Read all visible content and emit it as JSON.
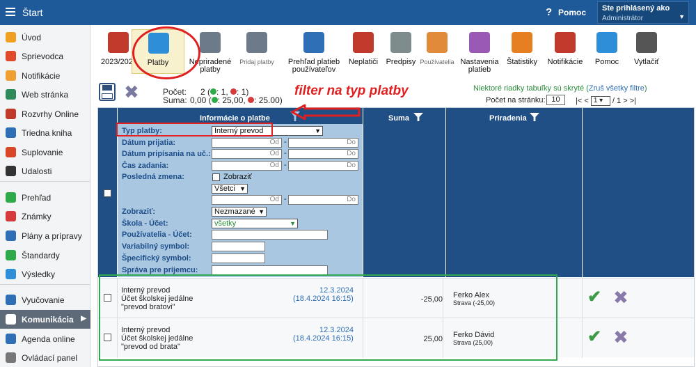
{
  "topbar": {
    "title": "Štart",
    "help_label": "Pomoc",
    "user_label": "Ste prihlásený ako",
    "user_role": "Administrátor"
  },
  "sidebar": {
    "items": [
      {
        "label": "Úvod",
        "icon": "star-icon",
        "color": "#f0a020"
      },
      {
        "label": "Sprievodca",
        "icon": "wand-icon",
        "color": "#e04a2a"
      },
      {
        "label": "Notifikácie",
        "icon": "envelope-icon",
        "color": "#f0a030"
      },
      {
        "label": "Web stránka",
        "icon": "home-icon",
        "color": "#2e8a5a"
      },
      {
        "label": "Rozvrhy Online",
        "icon": "calendar-icon",
        "color": "#c0392b"
      },
      {
        "label": "Triedna kniha",
        "icon": "book-icon",
        "color": "#2e6fb5"
      },
      {
        "label": "Suplovanie",
        "icon": "person-icon",
        "color": "#d9472b"
      },
      {
        "label": "Udalosti",
        "icon": "briefcase-icon",
        "color": "#333333"
      },
      {
        "label": "Prehľad",
        "icon": "check-circle-icon",
        "color": "#2eaa4a"
      },
      {
        "label": "Známky",
        "icon": "ribbon-icon",
        "color": "#d63a3a"
      },
      {
        "label": "Plány a prípravy",
        "icon": "suitcase-icon",
        "color": "#2e6fb5"
      },
      {
        "label": "Štandardy",
        "icon": "shield-icon",
        "color": "#2eaa4a"
      },
      {
        "label": "Výsledky",
        "icon": "bar-chart-icon",
        "color": "#2e8fd8"
      },
      {
        "label": "Vyučovanie",
        "icon": "laptop-icon",
        "color": "#2e6fb5"
      },
      {
        "label": "Komunikácia",
        "icon": "chat-icon",
        "color": "#ffffff"
      },
      {
        "label": "Agenda online",
        "icon": "pen-icon",
        "color": "#2e6fb5"
      },
      {
        "label": "Ovládací panel",
        "icon": "gear-icon",
        "color": "#777777"
      }
    ]
  },
  "toolbar": {
    "items": [
      {
        "label": "2023/2024",
        "icon": "calendar-icon",
        "color": "#c0392b"
      },
      {
        "label": "Platby",
        "icon": "money-bag-icon",
        "color": "#2e8fd8"
      },
      {
        "label": "Nepriradené platby",
        "icon": "money-bag-question-icon",
        "color": "#6c7a89"
      },
      {
        "label": "Pridaj platby",
        "icon": "money-bag-plus-icon",
        "color": "#6c7a89"
      },
      {
        "label": "Prehľad platieb používateľov",
        "icon": "ledger-icon",
        "color": "#2e6fb5"
      },
      {
        "label": "Neplatiči",
        "icon": "money-bag-clock-icon",
        "color": "#c0392b"
      },
      {
        "label": "Predpisy",
        "icon": "document-icon",
        "color": "#7f8c8d"
      },
      {
        "label": "Používatelia",
        "icon": "user-icon",
        "color": "#e08a3a"
      },
      {
        "label": "Nastavenia platieb",
        "icon": "cog-icon",
        "color": "#9b59b6"
      },
      {
        "label": "Štatistiky",
        "icon": "pie-chart-icon",
        "color": "#e67e22"
      },
      {
        "label": "Notifikácie",
        "icon": "phone-icon",
        "color": "#c0392b"
      },
      {
        "label": "Pomoc",
        "icon": "question-icon",
        "color": "#2e8fd8"
      },
      {
        "label": "Vytlačiť",
        "icon": "printer-icon",
        "color": "#555555"
      }
    ]
  },
  "summary": {
    "count_label": "Počet:",
    "count_value": "2 (",
    "count_plus": ": 1,",
    "count_minus": ": 1)",
    "sum_label": "Suma:",
    "sum_value": "0,00 (",
    "sum_plus": ": 25,00,",
    "sum_minus": ": 25.00)"
  },
  "annotation": {
    "text": "filter na typ platby"
  },
  "filter_info": {
    "hidden_text": "Niektoré riadky tabuľky sú skryté",
    "reset_link": "Zruš všetky filtre",
    "per_page_label": "Počet na stránku:",
    "per_page_value": "10",
    "page_value": "1",
    "page_total": "/ 1",
    "nav_first": "|<",
    "nav_prev": "<",
    "nav_next": ">",
    "nav_last": ">|"
  },
  "columns": {
    "info": "Informácie o platbe",
    "sum": "Suma",
    "assignment": "Priradenia"
  },
  "filters": {
    "type_label": "Typ platby:",
    "type_value": "Interný prevod",
    "date_received_label": "Dátum prijatia:",
    "date_credited_label": "Dátum pripísania na uč.:",
    "time_entered_label": "Čas zadania:",
    "last_change_label": "Posledná zmena:",
    "show_checkbox_label": "Zobraziť",
    "last_change_select": "Všetci",
    "from": "Od",
    "to": "Do",
    "dash": "-",
    "display_label": "Zobraziť:",
    "display_value": "Nezmazané",
    "school_label": "Škola - Účet:",
    "school_value": "všetky",
    "users_label": "Používatelia - Účet:",
    "variable_label": "Variabilný symbol:",
    "specific_label": "Špecifický symbol:",
    "message_label": "Správa pre príjemcu:"
  },
  "rows": [
    {
      "type": "Interný prevod",
      "account": "Účet školskej jedálne",
      "note": "\"prevod bratovi\"",
      "date": "12.3.2024",
      "datetime": "(18.4.2024 16:15)",
      "amount": "-25,00",
      "person": "Ferko Alex",
      "detail": "Strava (-25,00)"
    },
    {
      "type": "Interný prevod",
      "account": "Účet školskej jedálne",
      "note": "\"prevod od brata\"",
      "date": "12.3.2024",
      "datetime": "(18.4.2024 16:15)",
      "amount": "25,00",
      "person": "Ferko Dávid",
      "detail": "Strava (25,00)"
    }
  ]
}
